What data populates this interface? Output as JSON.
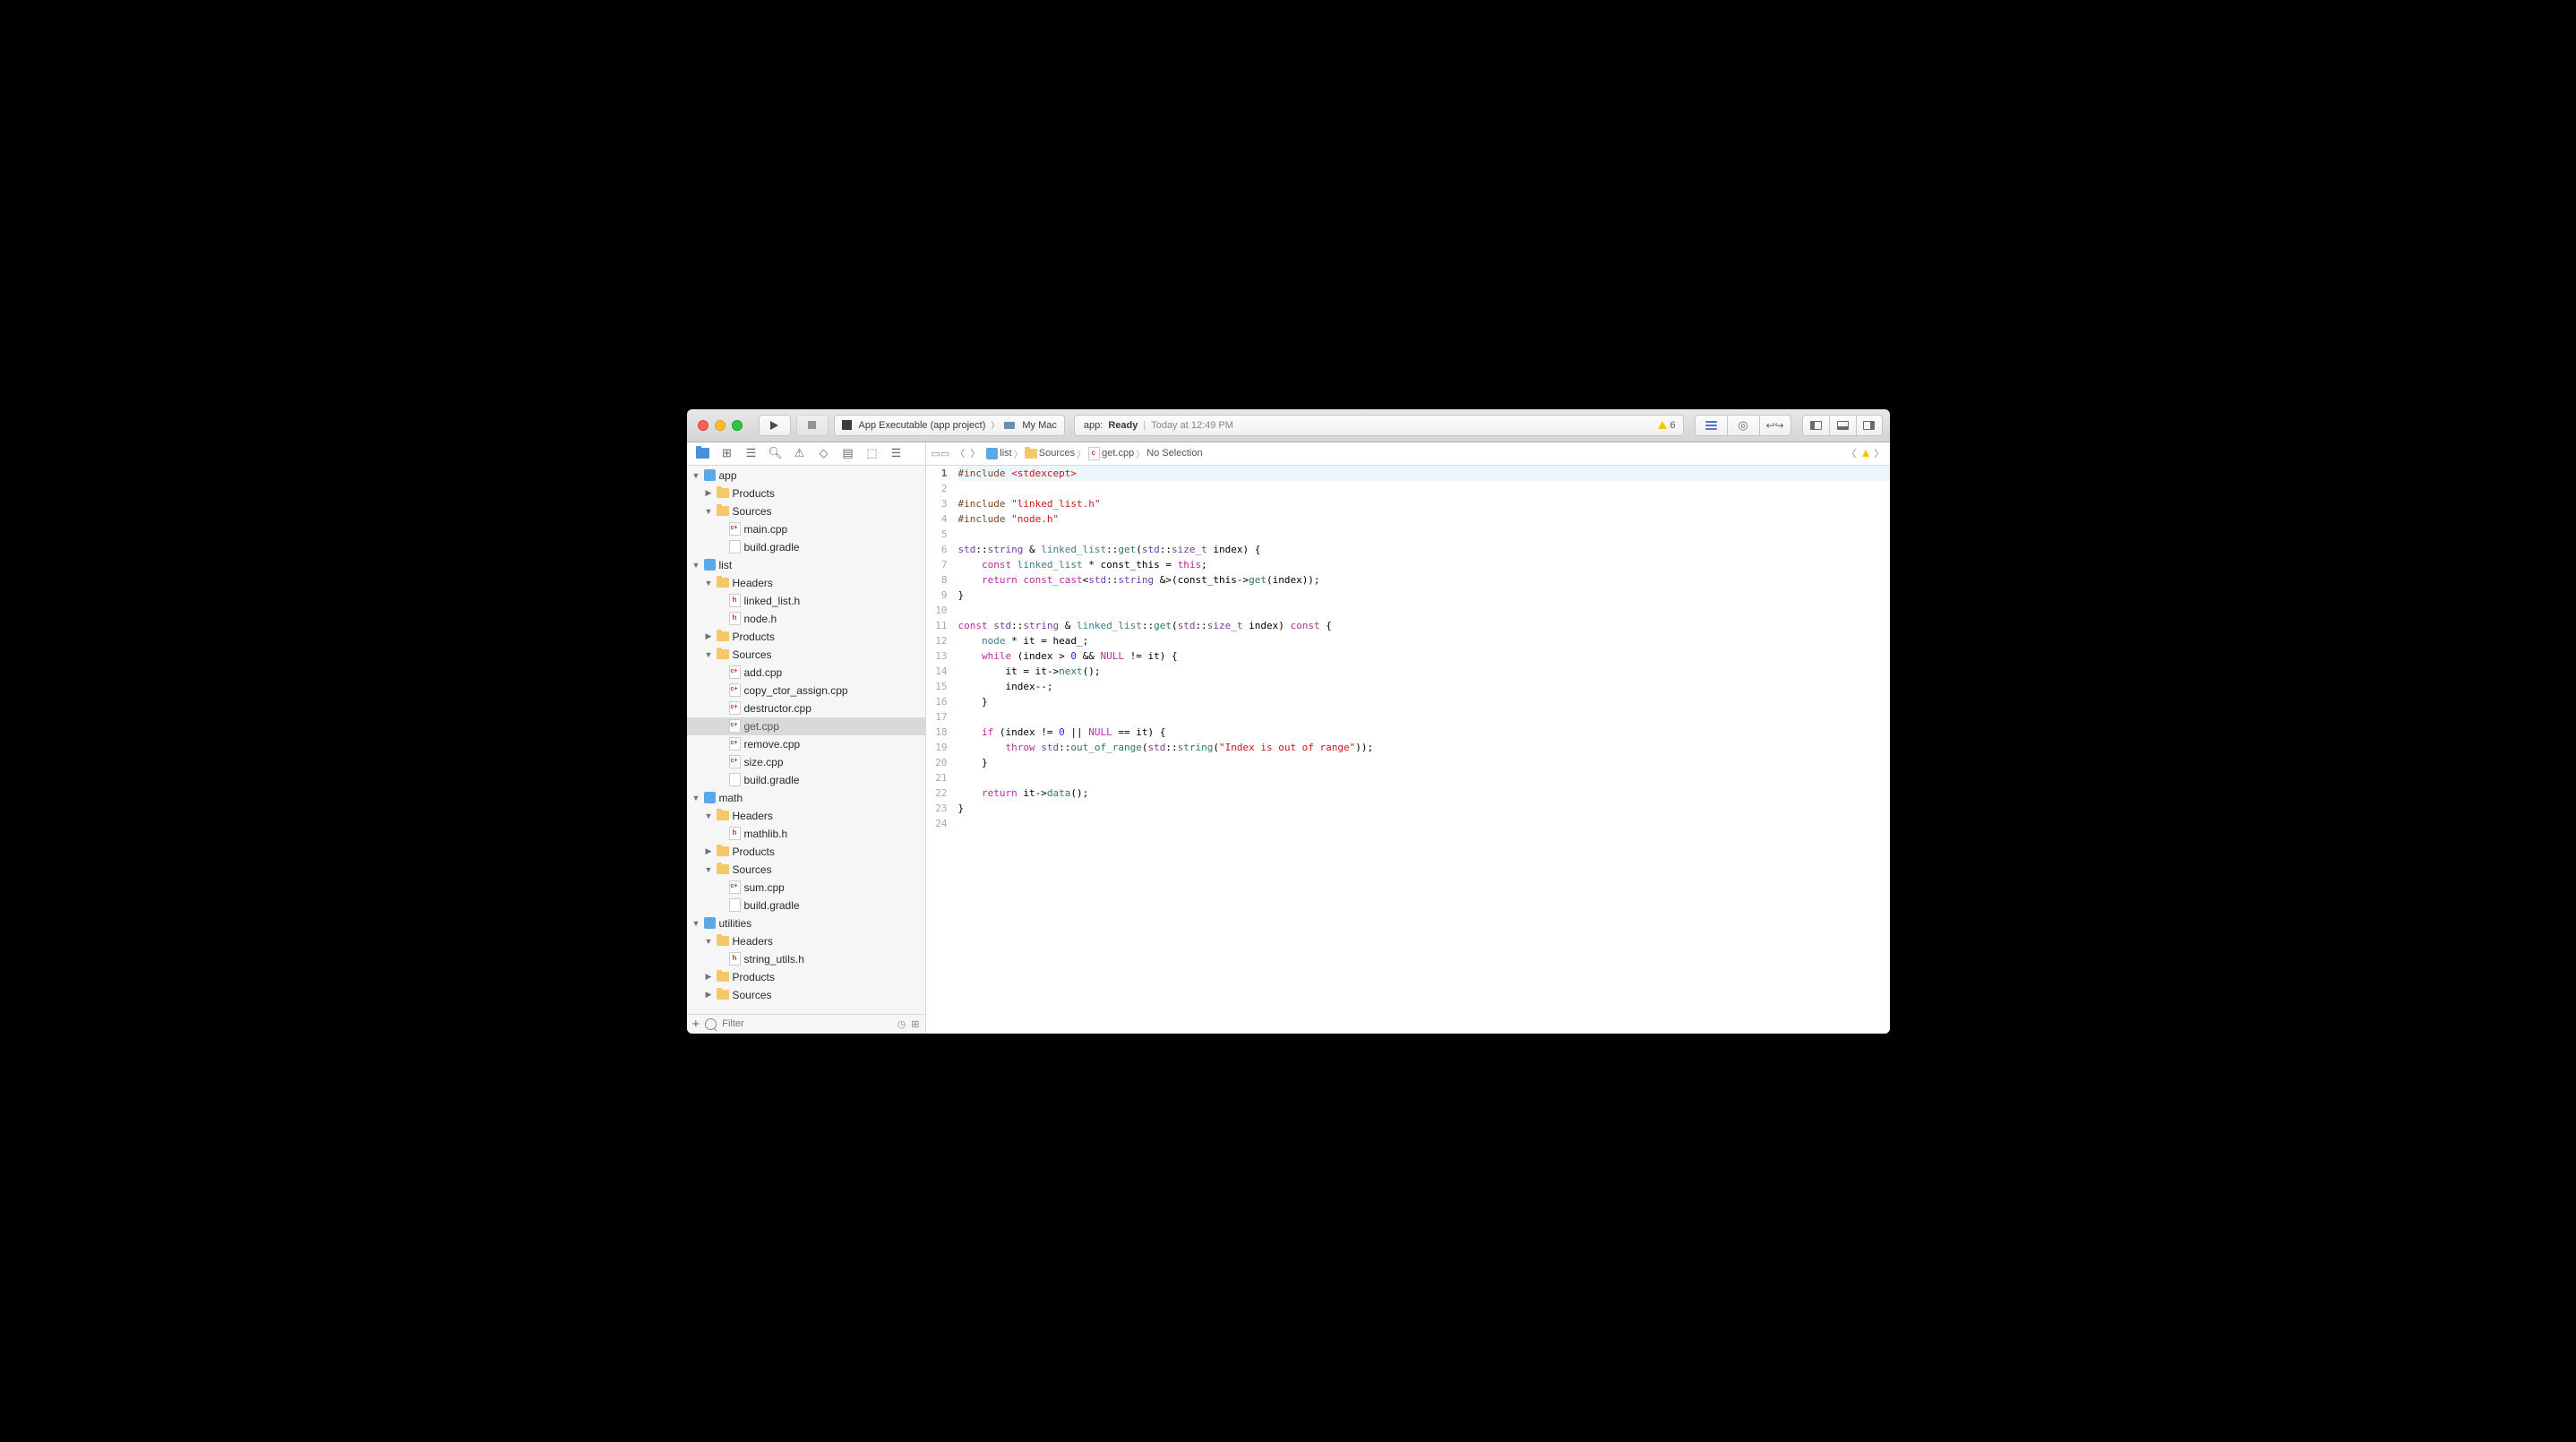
{
  "toolbar": {
    "scheme_target": "App Executable (app project)",
    "scheme_device": "My Mac",
    "status_app": "app:",
    "status_state": "Ready",
    "status_time": "Today at 12:49 PM",
    "warn_count": "6"
  },
  "breadcrumb": {
    "b1": "list",
    "b2": "Sources",
    "b3": "get.cpp",
    "b4": "No Selection"
  },
  "tree": [
    {
      "d": 0,
      "disc": "open",
      "icon": "proj",
      "label": "app"
    },
    {
      "d": 1,
      "disc": "closed",
      "icon": "fld",
      "label": "Products"
    },
    {
      "d": 1,
      "disc": "open",
      "icon": "fld",
      "label": "Sources"
    },
    {
      "d": 2,
      "disc": "none",
      "icon": "c",
      "label": "main.cpp"
    },
    {
      "d": 2,
      "disc": "none",
      "icon": "plain",
      "label": "build.gradle"
    },
    {
      "d": 0,
      "disc": "open",
      "icon": "proj",
      "label": "list"
    },
    {
      "d": 1,
      "disc": "open",
      "icon": "fld",
      "label": "Headers"
    },
    {
      "d": 2,
      "disc": "none",
      "icon": "h",
      "label": "linked_list.h"
    },
    {
      "d": 2,
      "disc": "none",
      "icon": "h",
      "label": "node.h"
    },
    {
      "d": 1,
      "disc": "closed",
      "icon": "fld",
      "label": "Products"
    },
    {
      "d": 1,
      "disc": "open",
      "icon": "fld",
      "label": "Sources"
    },
    {
      "d": 2,
      "disc": "none",
      "icon": "c",
      "label": "add.cpp"
    },
    {
      "d": 2,
      "disc": "none",
      "icon": "c",
      "label": "copy_ctor_assign.cpp"
    },
    {
      "d": 2,
      "disc": "none",
      "icon": "c",
      "label": "destructor.cpp"
    },
    {
      "d": 2,
      "disc": "none",
      "icon": "c",
      "label": "get.cpp",
      "sel": true
    },
    {
      "d": 2,
      "disc": "none",
      "icon": "c",
      "label": "remove.cpp"
    },
    {
      "d": 2,
      "disc": "none",
      "icon": "c",
      "label": "size.cpp"
    },
    {
      "d": 2,
      "disc": "none",
      "icon": "plain",
      "label": "build.gradle"
    },
    {
      "d": 0,
      "disc": "open",
      "icon": "proj",
      "label": "math"
    },
    {
      "d": 1,
      "disc": "open",
      "icon": "fld",
      "label": "Headers"
    },
    {
      "d": 2,
      "disc": "none",
      "icon": "h",
      "label": "mathlib.h"
    },
    {
      "d": 1,
      "disc": "closed",
      "icon": "fld",
      "label": "Products"
    },
    {
      "d": 1,
      "disc": "open",
      "icon": "fld",
      "label": "Sources"
    },
    {
      "d": 2,
      "disc": "none",
      "icon": "c",
      "label": "sum.cpp"
    },
    {
      "d": 2,
      "disc": "none",
      "icon": "plain",
      "label": "build.gradle"
    },
    {
      "d": 0,
      "disc": "open",
      "icon": "proj",
      "label": "utilities"
    },
    {
      "d": 1,
      "disc": "open",
      "icon": "fld",
      "label": "Headers"
    },
    {
      "d": 2,
      "disc": "none",
      "icon": "h",
      "label": "string_utils.h"
    },
    {
      "d": 1,
      "disc": "closed",
      "icon": "fld",
      "label": "Products"
    },
    {
      "d": 1,
      "disc": "closed",
      "icon": "fld",
      "label": "Sources"
    }
  ],
  "filter_placeholder": "Filter",
  "code": {
    "line_count": 24,
    "lines": [
      [
        [
          "pre",
          "#include "
        ],
        [
          "inc",
          "<stdexcept>"
        ]
      ],
      [],
      [
        [
          "pre",
          "#include "
        ],
        [
          "inc",
          "\"linked_list.h\""
        ]
      ],
      [
        [
          "pre",
          "#include "
        ],
        [
          "inc",
          "\"node.h\""
        ]
      ],
      [],
      [
        [
          "typ",
          "std"
        ],
        [
          "punc",
          "::"
        ],
        [
          "typ",
          "string"
        ],
        [
          "punc",
          " & "
        ],
        [
          "fn",
          "linked_list"
        ],
        [
          "punc",
          "::"
        ],
        [
          "fn2",
          "get"
        ],
        [
          "punc",
          "("
        ],
        [
          "typ",
          "std"
        ],
        [
          "punc",
          "::"
        ],
        [
          "typ",
          "size_t"
        ],
        [
          "punc",
          " index) {"
        ]
      ],
      [
        [
          "punc",
          "    "
        ],
        [
          "kw",
          "const"
        ],
        [
          "punc",
          " "
        ],
        [
          "fn",
          "linked_list"
        ],
        [
          "punc",
          " * const_this = "
        ],
        [
          "kw",
          "this"
        ],
        [
          "punc",
          ";"
        ]
      ],
      [
        [
          "punc",
          "    "
        ],
        [
          "kw",
          "return"
        ],
        [
          "punc",
          " "
        ],
        [
          "kw",
          "const_cast"
        ],
        [
          "punc",
          "<"
        ],
        [
          "typ",
          "std"
        ],
        [
          "punc",
          "::"
        ],
        [
          "typ",
          "string"
        ],
        [
          "punc",
          " &>(const_this->"
        ],
        [
          "fn2",
          "get"
        ],
        [
          "punc",
          "(index));"
        ]
      ],
      [
        [
          "punc",
          "}"
        ]
      ],
      [],
      [
        [
          "kw",
          "const"
        ],
        [
          "punc",
          " "
        ],
        [
          "typ",
          "std"
        ],
        [
          "punc",
          "::"
        ],
        [
          "typ",
          "string"
        ],
        [
          "punc",
          " & "
        ],
        [
          "fn",
          "linked_list"
        ],
        [
          "punc",
          "::"
        ],
        [
          "fn2",
          "get"
        ],
        [
          "punc",
          "("
        ],
        [
          "typ",
          "std"
        ],
        [
          "punc",
          "::"
        ],
        [
          "typ",
          "size_t"
        ],
        [
          "punc",
          " index) "
        ],
        [
          "kw",
          "const"
        ],
        [
          "punc",
          " {"
        ]
      ],
      [
        [
          "punc",
          "    "
        ],
        [
          "fn",
          "node"
        ],
        [
          "punc",
          " * it = head_;"
        ]
      ],
      [
        [
          "punc",
          "    "
        ],
        [
          "kw",
          "while"
        ],
        [
          "punc",
          " (index > "
        ],
        [
          "num",
          "0"
        ],
        [
          "punc",
          " && "
        ],
        [
          "kw",
          "NULL"
        ],
        [
          "punc",
          " != it) {"
        ]
      ],
      [
        [
          "punc",
          "        it = it->"
        ],
        [
          "fn2",
          "next"
        ],
        [
          "punc",
          "();"
        ]
      ],
      [
        [
          "punc",
          "        index--;"
        ]
      ],
      [
        [
          "punc",
          "    }"
        ]
      ],
      [],
      [
        [
          "punc",
          "    "
        ],
        [
          "kw",
          "if"
        ],
        [
          "punc",
          " (index != "
        ],
        [
          "num",
          "0"
        ],
        [
          "punc",
          " || "
        ],
        [
          "kw",
          "NULL"
        ],
        [
          "punc",
          " == it) {"
        ]
      ],
      [
        [
          "punc",
          "        "
        ],
        [
          "kw",
          "throw"
        ],
        [
          "punc",
          " "
        ],
        [
          "typ",
          "std"
        ],
        [
          "punc",
          "::"
        ],
        [
          "fn2",
          "out_of_range"
        ],
        [
          "punc",
          "("
        ],
        [
          "typ",
          "std"
        ],
        [
          "punc",
          "::"
        ],
        [
          "fn2",
          "string"
        ],
        [
          "punc",
          "("
        ],
        [
          "str",
          "\"Index is out of range\""
        ],
        [
          "punc",
          "));"
        ]
      ],
      [
        [
          "punc",
          "    }"
        ]
      ],
      [],
      [
        [
          "punc",
          "    "
        ],
        [
          "kw",
          "return"
        ],
        [
          "punc",
          " it->"
        ],
        [
          "fn2",
          "data"
        ],
        [
          "punc",
          "();"
        ]
      ],
      [
        [
          "punc",
          "}"
        ]
      ],
      []
    ]
  }
}
